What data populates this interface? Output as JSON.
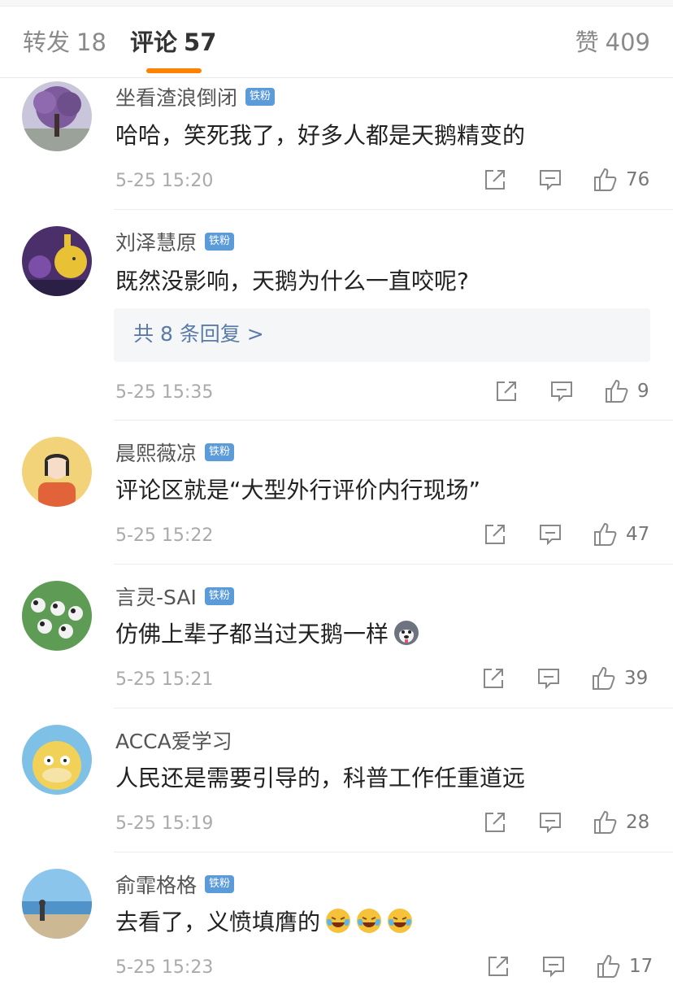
{
  "tabs": {
    "repost_label": "转发",
    "repost_count": "18",
    "comments_label": "评论",
    "comments_count": "57",
    "likes_label": "赞",
    "likes_count": "409"
  },
  "colors": {
    "accent": "#ff8200",
    "badge": "#5b9bd9",
    "reply_link": "#5a7ba6"
  },
  "comments": [
    {
      "username": "坐看渣浪倒闭",
      "badge": "铁粉",
      "text": "哈哈，笑死我了，好多人都是天鹅精变的",
      "time": "5-25 15:20",
      "likes": "76",
      "avatar": "tree-avatar"
    },
    {
      "username": "刘泽慧原",
      "badge": "铁粉",
      "text": "既然没影响，天鹅为什么一直咬呢?",
      "reply_summary": "共 8 条回复 >",
      "time": "5-25 15:35",
      "likes": "9",
      "avatar": "cartoon-avatar"
    },
    {
      "username": "晨熙薇凉",
      "badge": "铁粉",
      "text": "评论区就是“大型外行评价内行现场”",
      "time": "5-25 15:22",
      "likes": "47",
      "avatar": "girl-avatar"
    },
    {
      "username": "言灵-SAI",
      "badge": "铁粉",
      "text": "仿佛上辈子都当过天鹅一样",
      "emoji": "husky-emoji",
      "time": "5-25 15:21",
      "likes": "39",
      "avatar": "pandas-avatar"
    },
    {
      "username": "ACCA爱学习",
      "text": "人民还是需要引导的，科普工作任重道远",
      "time": "5-25 15:19",
      "likes": "28",
      "avatar": "psyduck-avatar"
    },
    {
      "username": "俞霏格格",
      "badge": "铁粉",
      "text": "去看了，义愤填膺的",
      "emoji": "laugh-cry-emoji x3",
      "time": "5-25 15:23",
      "likes": "17",
      "avatar": "beach-avatar"
    }
  ]
}
